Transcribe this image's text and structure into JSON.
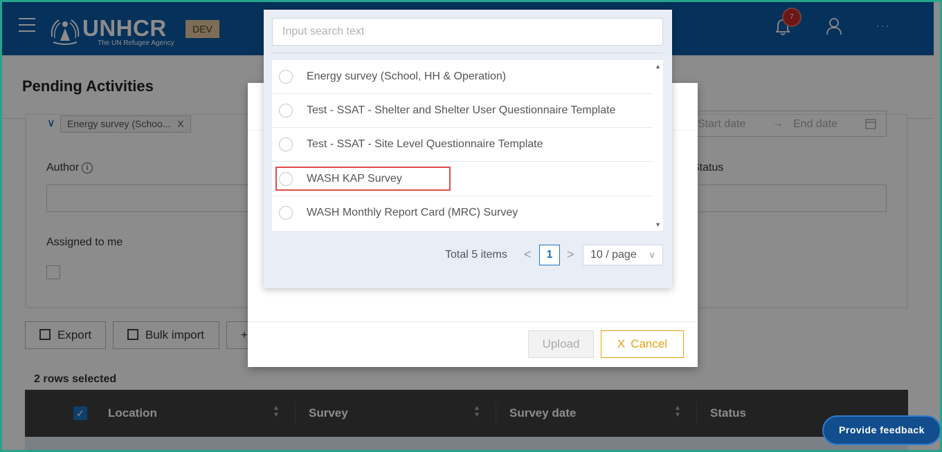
{
  "header": {
    "logo_text": "UNHCR",
    "logo_subtitle": "The UN Refugee Agency",
    "env_badge": "DEV",
    "notification_count": "7",
    "more_label": "···"
  },
  "page": {
    "title": "Pending Activities",
    "filters": {
      "survey_chip": "Energy survey (Schoo...",
      "chip_remove": "X",
      "start_date_placeholder": "Start date",
      "date_arrow": "→",
      "end_date_placeholder": "End date",
      "author_label": "Author",
      "info_glyph": "i",
      "status_label": "Status",
      "assigned_label": "Assigned to me"
    },
    "actions": {
      "export_label": "Export",
      "bulk_import_label": "Bulk import",
      "add_label": "+"
    },
    "rows_selected": "2 rows selected",
    "table": {
      "columns": [
        "Location",
        "Survey",
        "Survey date",
        "Status"
      ],
      "check_glyph": "✓"
    }
  },
  "modal": {
    "upload_label": "Upload",
    "cancel_label": "Cancel",
    "cancel_glyph": "X"
  },
  "dropdown": {
    "search_placeholder": "Input search text",
    "items": [
      {
        "label": "Energy survey (School, HH & Operation)"
      },
      {
        "label": "Test - SSAT - Shelter and Shelter User Questionnaire Template"
      },
      {
        "label": "Test - SSAT - Site Level Questionnaire Template"
      },
      {
        "label": "WASH KAP Survey"
      },
      {
        "label": "WASH Monthly Report Card (MRC) Survey"
      }
    ],
    "pagination": {
      "total": "Total 5 items",
      "prev_glyph": "<",
      "current_page": "1",
      "next_glyph": ">",
      "page_size": "10 / page"
    }
  },
  "feedback_label": "Provide feedback",
  "colors": {
    "header_bg": "#0b5aa5",
    "accent": "#e5a20e",
    "highlight": "#e04b4b",
    "primary": "#1d73c4"
  }
}
